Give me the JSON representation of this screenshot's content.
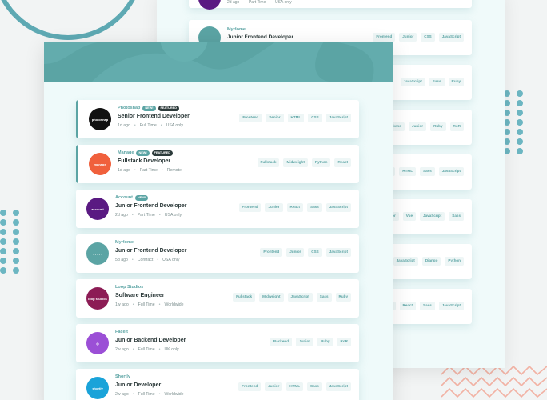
{
  "colors": {
    "accent": "#5ba4a4",
    "dark": "#2c3a3a",
    "muted": "#7b8e8e",
    "tag_bg": "#eef6f6"
  },
  "back_list": {
    "top_meta": [
      "2d ago",
      "Part Time",
      "USA only"
    ],
    "visible_card": {
      "company": "MyHome",
      "position": "Junior Frontend Developer",
      "tags": [
        "Frontend",
        "Junior",
        "CSS",
        "JavaScript"
      ]
    },
    "partial_tags": [
      [
        "JavaScript",
        "Sass",
        "Ruby"
      ],
      [
        "Backend",
        "Junior",
        "Ruby",
        "RoR"
      ],
      [
        "Junior",
        "HTML",
        "Sass",
        "JavaScript"
      ],
      [
        "Junior",
        "Vue",
        "JavaScript",
        "Sass"
      ],
      [
        "JavaScript",
        "Django",
        "Python"
      ],
      [
        "Junior",
        "React",
        "Sass",
        "JavaScript"
      ]
    ]
  },
  "jobs": [
    {
      "company": "Photosnap",
      "logo_text": "photosnap",
      "logo_color": "#111111",
      "new_label": "New!",
      "featured_label": "Featured",
      "position": "Senior Frontend Developer",
      "posted": "1d ago",
      "contract": "Full Time",
      "location": "USA only",
      "tags": [
        "Frontend",
        "Senior",
        "HTML",
        "CSS",
        "JavaScript"
      ]
    },
    {
      "company": "Manage",
      "logo_text": "manage",
      "logo_color": "#f0603c",
      "new_label": "New!",
      "featured_label": "Featured",
      "position": "Fullstack Developer",
      "posted": "1d ago",
      "contract": "Part Time",
      "location": "Remote",
      "tags": [
        "Fullstack",
        "Midweight",
        "Python",
        "React"
      ]
    },
    {
      "company": "Account",
      "logo_text": "account",
      "logo_color": "#5a1a82",
      "new_label": "New!",
      "featured_label": null,
      "position": "Junior Frontend Developer",
      "posted": "2d ago",
      "contract": "Part Time",
      "location": "USA only",
      "tags": [
        "Frontend",
        "Junior",
        "React",
        "Sass",
        "JavaScript"
      ]
    },
    {
      "company": "MyHome",
      "logo_text": "• • • • •",
      "logo_color": "#5ba4a4",
      "new_label": null,
      "featured_label": null,
      "position": "Junior Frontend Developer",
      "posted": "5d ago",
      "contract": "Contract",
      "location": "USA only",
      "tags": [
        "Frontend",
        "Junior",
        "CSS",
        "JavaScript"
      ]
    },
    {
      "company": "Loop Studios",
      "logo_text": "loop studios",
      "logo_color": "#8c1c55",
      "new_label": null,
      "featured_label": null,
      "position": "Software Engineer",
      "posted": "1w ago",
      "contract": "Full Time",
      "location": "Worldwide",
      "tags": [
        "Fullstack",
        "Midweight",
        "JavaScript",
        "Sass",
        "Ruby"
      ]
    },
    {
      "company": "FaceIt",
      "logo_text": "◎",
      "logo_color": "#9b4fd6",
      "new_label": null,
      "featured_label": null,
      "position": "Junior Backend Developer",
      "posted": "2w ago",
      "contract": "Full Time",
      "location": "UK only",
      "tags": [
        "Backend",
        "Junior",
        "Ruby",
        "RoR"
      ]
    },
    {
      "company": "Shortly",
      "logo_text": "shortly",
      "logo_color": "#1aa3d9",
      "new_label": null,
      "featured_label": null,
      "position": "Junior Developer",
      "posted": "2w ago",
      "contract": "Full Time",
      "location": "Worldwide",
      "tags": [
        "Frontend",
        "Junior",
        "HTML",
        "Sass",
        "JavaScript"
      ]
    }
  ]
}
